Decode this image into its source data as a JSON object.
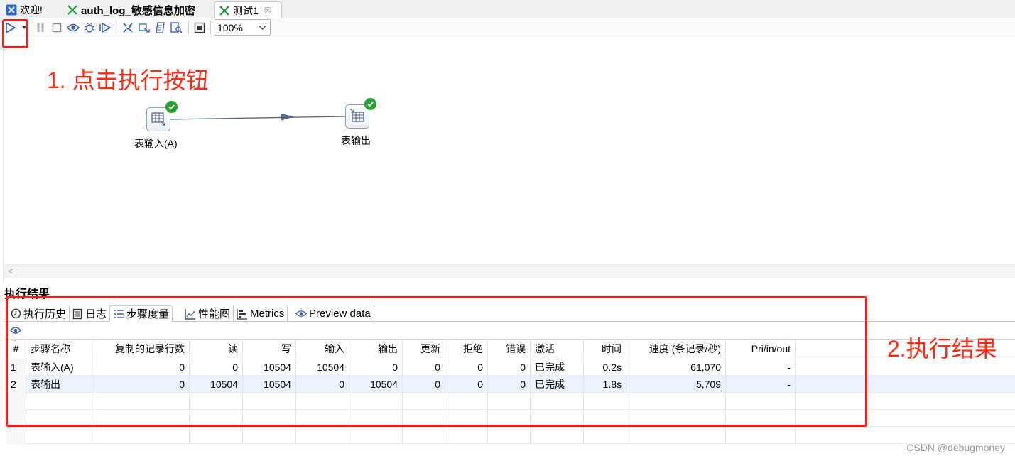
{
  "tabs": [
    {
      "label": "欢迎!",
      "icon": "spoon-icon"
    },
    {
      "label": "auth_log_敏感信息加密",
      "icon": "transformation-icon"
    },
    {
      "label": "测试1",
      "icon": "transformation-icon",
      "close": "☒"
    }
  ],
  "toolbar": {
    "zoom_value": "100%",
    "icons": [
      "run-icon",
      "run-options-chevron-icon",
      "pause-icon",
      "stop-icon",
      "preview-icon",
      "debug-icon",
      "replay-icon",
      "verify-icon",
      "impact-analysis-icon",
      "sql-icon",
      "explore-db-icon",
      "show-results-icon"
    ]
  },
  "canvas": {
    "steps": [
      {
        "label": "表输入(A)",
        "status": "success",
        "icon": "table-input-icon"
      },
      {
        "label": "表输出",
        "status": "success",
        "icon": "table-output-icon"
      }
    ]
  },
  "annotations": {
    "step1": "1. 点击执行按钮",
    "step2": "2.执行结果",
    "color": "#ff2a14"
  },
  "results": {
    "title": "执行结果",
    "tabs": [
      {
        "label": "执行历史",
        "icon": "history-icon"
      },
      {
        "label": "日志",
        "icon": "log-icon"
      },
      {
        "label": "步骤度量",
        "icon": "step-metrics-icon",
        "active": true
      },
      {
        "label": "性能图",
        "icon": "performance-chart-icon"
      },
      {
        "label": "Metrics",
        "icon": "metrics-icon"
      },
      {
        "label": "Preview data",
        "icon": "preview-data-icon"
      }
    ],
    "columns": [
      "#",
      "步骤名称",
      "复制的记录行数",
      "读",
      "写",
      "输入",
      "输出",
      "更新",
      "拒绝",
      "错误",
      "激活",
      "时间",
      "速度 (条记录/秒)",
      "Pri/in/out"
    ],
    "rows": [
      [
        "1",
        "表输入(A)",
        "0",
        "0",
        "10504",
        "10504",
        "0",
        "0",
        "0",
        "0",
        "已完成",
        "0.2s",
        "61,070",
        "-"
      ],
      [
        "2",
        "表输出",
        "0",
        "10504",
        "10504",
        "0",
        "10504",
        "0",
        "0",
        "0",
        "已完成",
        "1.8s",
        "5,709",
        "-"
      ]
    ]
  },
  "watermark": "CSDN @debugmoney"
}
